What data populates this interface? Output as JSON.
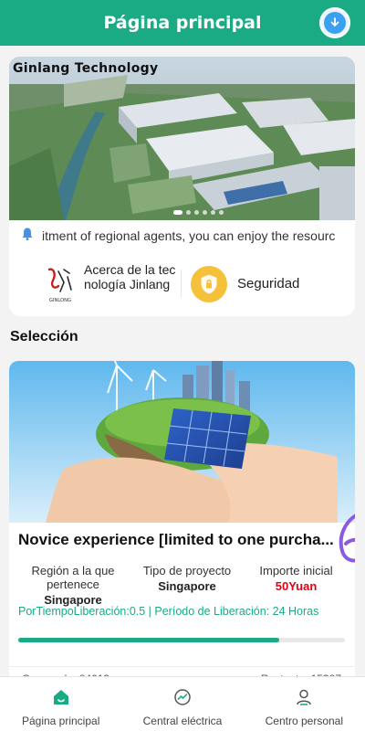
{
  "header": {
    "title": "Página principal"
  },
  "banner": {
    "label": "Ginlang Technology",
    "slides": 6,
    "active_slide": 0
  },
  "notice": {
    "text": "itment of regional agents, you can enjoy the resourc"
  },
  "about": {
    "label": "Acerca de la tecnología Jinlang",
    "logo_text": "GINLONG"
  },
  "security": {
    "label": "Seguridad"
  },
  "section": {
    "title": "Selección"
  },
  "product": {
    "title": "Novice experience [limited to one purcha...",
    "region_label": "Región a la que pertenece",
    "region_value": "Singapore",
    "type_label": "Tipo de proyecto",
    "type_value": "Singapore",
    "amount_label": "Importe inicial",
    "amount_value": "50Yuan",
    "release_text": "PorTiempoLiberación:0.5  | Período de Liberación:  24 Horas",
    "progress": 0.8,
    "stat_left": "Comprado: 84613",
    "stat_right": "Restante: 15387"
  },
  "tabbar": {
    "items": [
      {
        "label": "Página principal",
        "icon": "home-icon"
      },
      {
        "label": "Central eléctrica",
        "icon": "power-station-icon"
      },
      {
        "label": "Centro personal",
        "icon": "user-icon"
      }
    ]
  },
  "colors": {
    "brand": "#1aab84",
    "accent_red": "#e60012",
    "security": "#f6c13a"
  }
}
